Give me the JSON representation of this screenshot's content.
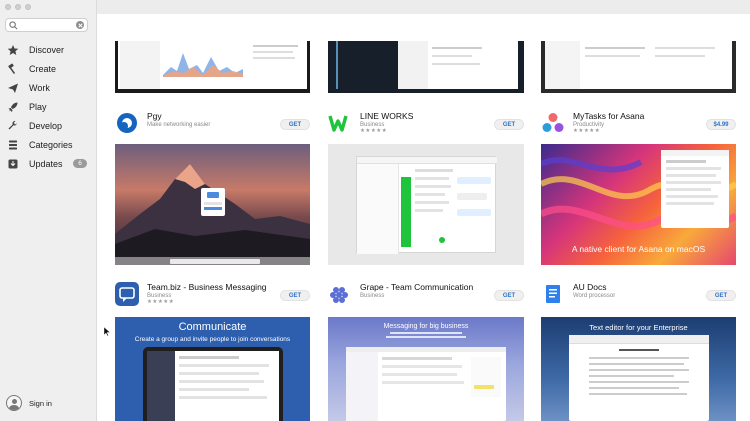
{
  "sidebar": {
    "search": {
      "value": "",
      "placeholder": ""
    },
    "items": [
      {
        "label": "Discover",
        "icon": "star-icon"
      },
      {
        "label": "Create",
        "icon": "hammer-icon"
      },
      {
        "label": "Work",
        "icon": "paper-plane-icon"
      },
      {
        "label": "Play",
        "icon": "rocket-icon"
      },
      {
        "label": "Develop",
        "icon": "wrench-icon"
      },
      {
        "label": "Categories",
        "icon": "stack-icon"
      },
      {
        "label": "Updates",
        "icon": "download-icon",
        "badge": "6"
      }
    ],
    "signin": "Sign in"
  },
  "apps": [
    {
      "name": "Pgy",
      "category": "Make networking easier",
      "rating": "",
      "button": "GET"
    },
    {
      "name": "LINE WORKS",
      "category": "Business",
      "rating": "★★★★★",
      "button": "GET"
    },
    {
      "name": "MyTasks for Asana",
      "category": "Productivity",
      "rating": "★★★★★",
      "button": "$4.99"
    },
    {
      "name": "Team.biz - Business Messaging",
      "category": "Business",
      "rating": "★★★★★",
      "button": "GET"
    },
    {
      "name": "Grape - Team Communication",
      "category": "Business",
      "rating": "",
      "button": "GET"
    },
    {
      "name": "AU Docs",
      "category": "Word processor",
      "rating": "",
      "button": "GET"
    }
  ],
  "screenshots": {
    "asana_caption": "A native client for Asana on macOS",
    "teambiz_title": "Communicate",
    "teambiz_sub": "Create a group and invite people to join conversations",
    "grape_title": "Messaging for big business",
    "audocs_title": "Text editor for your Enterprise"
  },
  "colors": {
    "accent": "#2f72c6",
    "line_green": "#1ec43b",
    "teambiz_blue": "#2d5fae",
    "grape_blue": "#5b6fd6",
    "asana_pink": "#f06a6a"
  }
}
